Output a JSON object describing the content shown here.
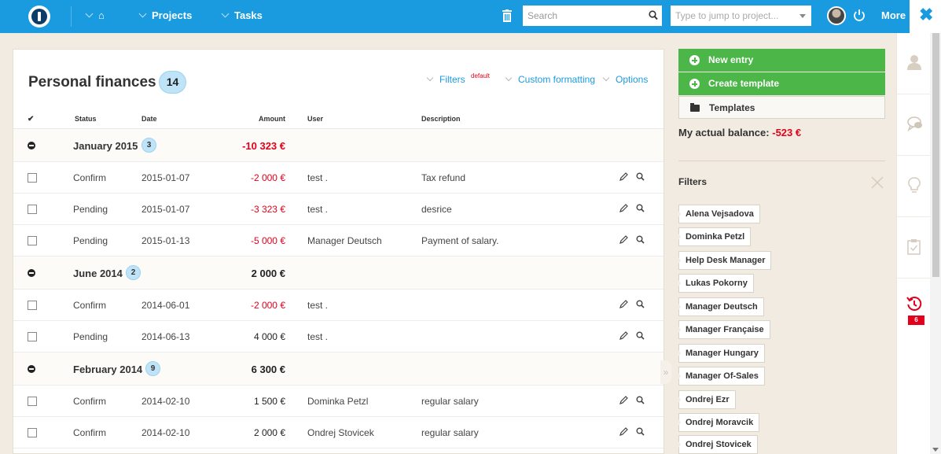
{
  "topbar": {
    "home_icon": "home-icon",
    "nav": {
      "projects": "Projects",
      "tasks": "Tasks"
    },
    "search": {
      "placeholder": "Search",
      "value": ""
    },
    "jump": {
      "placeholder": "Type to jump to project..."
    },
    "more": "More",
    "accent": "#1a9be0"
  },
  "page": {
    "title": "Personal finances",
    "count": "14",
    "toolbar": {
      "filters": "Filters",
      "filters_tag": "default",
      "custom_formatting": "Custom formatting",
      "options": "Options"
    }
  },
  "table": {
    "columns": {
      "check": "✔",
      "status": "Status",
      "date": "Date",
      "amount": "Amount",
      "user": "User",
      "description": "Description"
    },
    "groups": [
      {
        "name": "January 2015",
        "count": "3",
        "total": "-10 323 €",
        "negative": true,
        "rows": [
          {
            "status": "Confirm",
            "date": "2015-01-07",
            "amount": "-2 000 €",
            "negative": true,
            "user": "test .",
            "description": "Tax refund"
          },
          {
            "status": "Pending",
            "date": "2015-01-07",
            "amount": "-3 323 €",
            "negative": true,
            "user": "test .",
            "description": "desrice"
          },
          {
            "status": "Pending",
            "date": "2015-01-13",
            "amount": "-5 000 €",
            "negative": true,
            "user": "Manager Deutsch",
            "description": "Payment of salary."
          }
        ]
      },
      {
        "name": "June 2014",
        "count": "2",
        "total": "2 000 €",
        "negative": false,
        "rows": [
          {
            "status": "Confirm",
            "date": "2014-06-01",
            "amount": "-2 000 €",
            "negative": true,
            "user": "test .",
            "description": ""
          },
          {
            "status": "Pending",
            "date": "2014-06-13",
            "amount": "4 000 €",
            "negative": false,
            "user": "test .",
            "description": ""
          }
        ]
      },
      {
        "name": "February 2014",
        "count": "9",
        "total": "6 300 €",
        "negative": false,
        "rows": [
          {
            "status": "Confirm",
            "date": "2014-02-10",
            "amount": "1 500 €",
            "negative": false,
            "user": "Dominka Petzl",
            "description": "regular salary"
          },
          {
            "status": "Confirm",
            "date": "2014-02-10",
            "amount": "2 000 €",
            "negative": false,
            "user": "Ondrej Stovicek",
            "description": "regular salary"
          }
        ]
      }
    ]
  },
  "sidebar": {
    "new_entry": "New entry",
    "create_template": "Create template",
    "templates": "Templates",
    "balance_label": "My actual balance:",
    "balance_value": "-523 €",
    "filters_title": "Filters",
    "filter_tags": [
      "Alena Vejsadova",
      "Dominka Petzl",
      "Help Desk Manager",
      "Lukas Pokorny",
      "Manager Deutsch",
      "Manager Française",
      "Manager Hungary",
      "Manager Of-Sales",
      "Ondrej Ezr",
      "Ondrej Moravcik",
      "Ondrej Stovicek"
    ],
    "green": "#4cb648"
  },
  "rail": {
    "icons": [
      "user-icon",
      "chat-icon",
      "lightbulb-icon",
      "clipboard-icon",
      "history-icon"
    ],
    "history_badge": "6"
  }
}
